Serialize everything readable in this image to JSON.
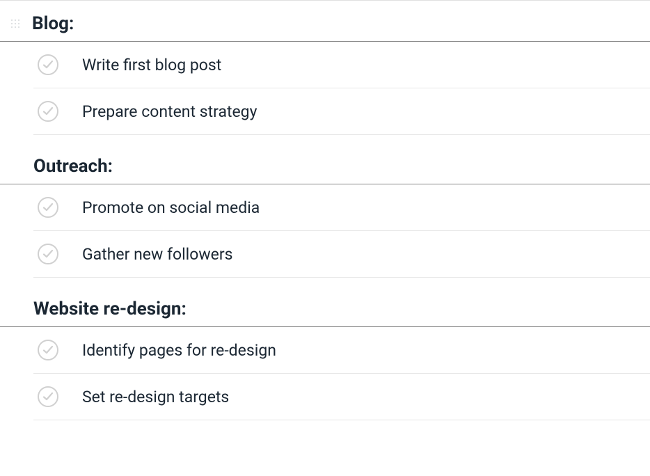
{
  "sections": [
    {
      "title": "Blog:",
      "tasks": [
        {
          "label": "Write first blog post"
        },
        {
          "label": "Prepare content strategy"
        }
      ]
    },
    {
      "title": "Outreach:",
      "tasks": [
        {
          "label": "Promote on social media"
        },
        {
          "label": "Gather new followers"
        }
      ]
    },
    {
      "title": "Website re-design:",
      "tasks": [
        {
          "label": "Identify pages for re-design"
        },
        {
          "label": "Set re-design targets"
        }
      ]
    }
  ]
}
